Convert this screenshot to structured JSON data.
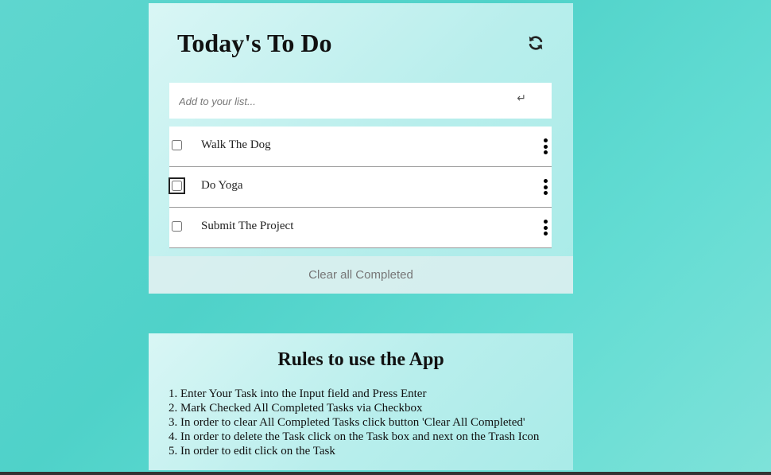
{
  "todo": {
    "title": "Today's To Do",
    "refresh_icon": "refresh-icon",
    "input": {
      "placeholder": "Add to your list...",
      "value": "",
      "enter_icon": "↵"
    },
    "tasks": [
      {
        "label": "Walk The Dog",
        "checked": false
      },
      {
        "label": "Do Yoga",
        "checked": false,
        "focused": true
      },
      {
        "label": "Submit The Project",
        "checked": false
      }
    ],
    "clear_label": "Clear all Completed"
  },
  "rules": {
    "title": "Rules to use the App",
    "items": [
      "Enter Your Task into the Input field and Press Enter",
      "Mark Checked All Completed Tasks via Checkbox",
      "In order to clear All Completed Tasks click button 'Clear All Completed'",
      "In order to delete the Task click on the Task box and next on the Trash Icon",
      "In order to edit click on the Task"
    ]
  },
  "colors": {
    "background": "#4fd2c9",
    "card": "#c6f1ef",
    "clear_text": "#777777"
  }
}
